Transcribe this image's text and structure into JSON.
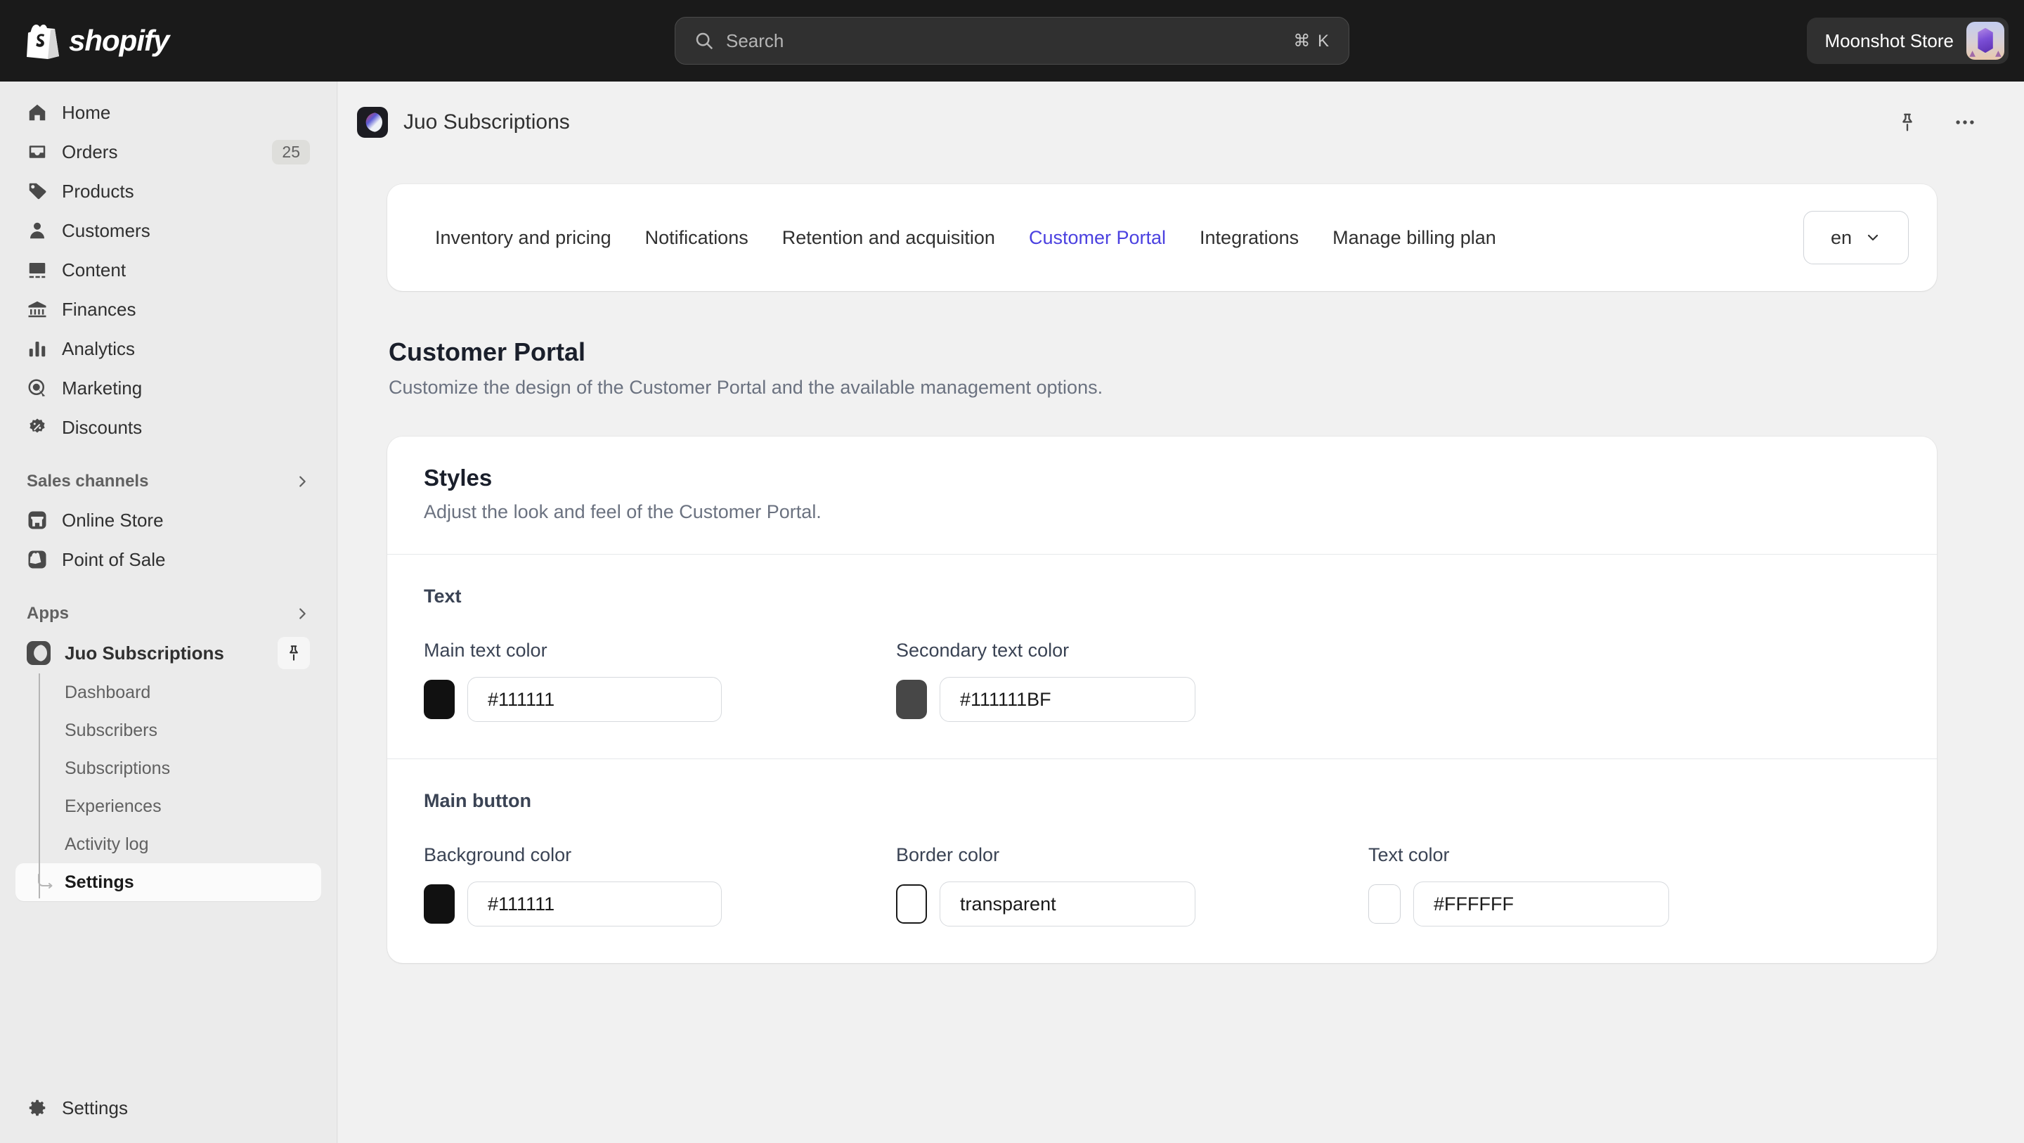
{
  "topbar": {
    "brand": "shopify",
    "search": {
      "placeholder": "Search",
      "shortcut": "⌘ K",
      "icon": "search-icon"
    },
    "notifications_icon": "bell-icon",
    "store_name": "Moonshot Store",
    "avatar_icon": "store-avatar"
  },
  "sidebar": {
    "items": [
      {
        "label": "Home",
        "icon": "home-icon"
      },
      {
        "label": "Orders",
        "icon": "orders-inbox-icon",
        "badge": "25"
      },
      {
        "label": "Products",
        "icon": "tag-icon"
      },
      {
        "label": "Customers",
        "icon": "person-icon"
      },
      {
        "label": "Content",
        "icon": "image-icon"
      },
      {
        "label": "Finances",
        "icon": "bank-icon"
      },
      {
        "label": "Analytics",
        "icon": "bar-chart-icon"
      },
      {
        "label": "Marketing",
        "icon": "target-cursor-icon"
      },
      {
        "label": "Discounts",
        "icon": "discount-badge-icon"
      }
    ],
    "sections": [
      {
        "label": "Sales channels",
        "chevron": "chevron-right-icon"
      },
      {
        "label": "Apps",
        "chevron": "chevron-right-icon"
      }
    ],
    "channels": [
      {
        "label": "Online Store",
        "icon": "storefront-icon"
      },
      {
        "label": "Point of Sale",
        "icon": "pos-bag-icon"
      }
    ],
    "app": {
      "label": "Juo Subscriptions",
      "icon": "juo-moon-icon",
      "pin_icon": "pin-icon",
      "subitems": [
        {
          "label": "Dashboard",
          "active": false
        },
        {
          "label": "Subscribers",
          "active": false
        },
        {
          "label": "Subscriptions",
          "active": false
        },
        {
          "label": "Experiences",
          "active": false
        },
        {
          "label": "Activity log",
          "active": false
        },
        {
          "label": "Settings",
          "active": true
        }
      ]
    },
    "settings_bottom": {
      "label": "Settings",
      "icon": "gear-icon"
    }
  },
  "app_header": {
    "title": "Juo Subscriptions",
    "icon": "juo-moon-icon",
    "pin_icon": "pin-icon",
    "more_icon": "ellipsis-horizontal-icon"
  },
  "tabs": {
    "items": [
      {
        "label": "Inventory and pricing",
        "active": false
      },
      {
        "label": "Notifications",
        "active": false
      },
      {
        "label": "Retention and acquisition",
        "active": false
      },
      {
        "label": "Customer Portal",
        "active": true
      },
      {
        "label": "Integrations",
        "active": false
      },
      {
        "label": "Manage billing plan",
        "active": false
      }
    ],
    "language": {
      "value": "en",
      "chevron": "chevron-down-icon"
    },
    "active_color": "#4b41e0"
  },
  "page": {
    "title": "Customer Portal",
    "subtitle": "Customize the design of the Customer Portal and the available management options."
  },
  "styles_card": {
    "title": "Styles",
    "subtitle": "Adjust the look and feel of the Customer Portal.",
    "groups": [
      {
        "title": "Text",
        "fields": [
          {
            "label": "Main text color",
            "value": "#111111",
            "swatch": "#111111",
            "swatch_style": "solid"
          },
          {
            "label": "Secondary text color",
            "value": "#111111BF",
            "swatch": "#474747",
            "swatch_style": "solid"
          }
        ]
      },
      {
        "title": "Main button",
        "fields": [
          {
            "label": "Background color",
            "value": "#111111",
            "swatch": "#111111",
            "swatch_style": "solid"
          },
          {
            "label": "Border color",
            "value": "transparent",
            "swatch": "#ffffff",
            "swatch_style": "outline"
          },
          {
            "label": "Text color",
            "value": "#FFFFFF",
            "swatch": "#ffffff",
            "swatch_style": "light"
          }
        ]
      }
    ]
  }
}
